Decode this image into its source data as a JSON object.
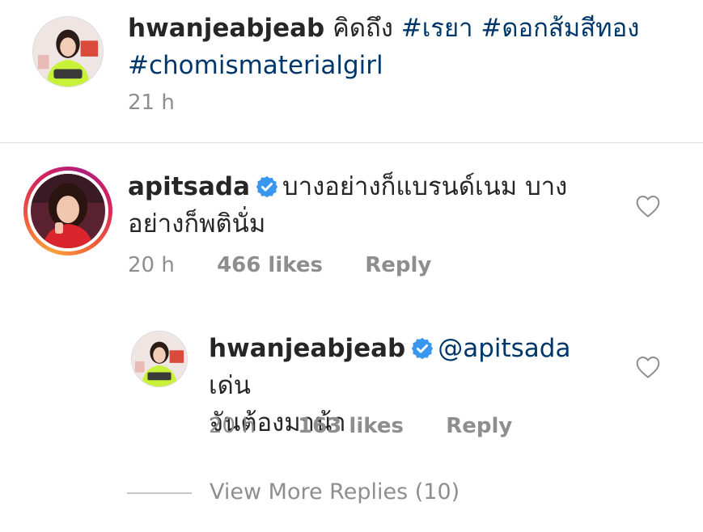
{
  "caption": {
    "username": "hwanjeabjeab",
    "text": "คิดถึง",
    "tags": [
      "#เรยา",
      "#ดอกส้มสีทอง",
      "#chomismaterialgirl"
    ],
    "time": "21 h"
  },
  "comment": {
    "username": "apitsada",
    "verified": true,
    "text_line1": "บางอย่างก็แบรนด์เนม บาง",
    "text_line2": "อย่างก็พตินั่ม",
    "time": "20 h",
    "likes": "466 likes",
    "reply_label": "Reply",
    "like_icon": "heart-outline-icon"
  },
  "reply": {
    "username": "hwanjeabjeab",
    "verified": true,
    "mention": "@apitsada",
    "text_line1": "เด่น",
    "text_line2": "จันต้องมาน้า",
    "time": "20 h",
    "likes": "163 likes",
    "reply_label": "Reply",
    "like_icon": "heart-outline-icon"
  },
  "view_more": {
    "label": "View More Replies (10)"
  },
  "colors": {
    "text": "#262626",
    "hashtag": "#00376b",
    "muted": "#8e8e8e",
    "verified": "#3897f0"
  }
}
